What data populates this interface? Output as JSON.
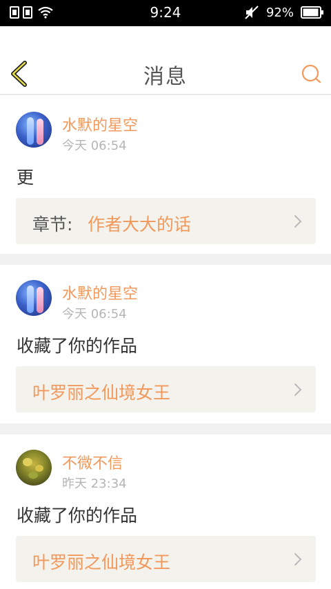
{
  "status_bar": {
    "time": "9:24",
    "battery": "92%",
    "icons": [
      "sim-card-icon",
      "sim-card-icon",
      "wifi-icon",
      "mute-icon",
      "battery-icon"
    ]
  },
  "header": {
    "title": "消息",
    "back_icon": "back-chevron-icon",
    "search_icon": "search-icon"
  },
  "accent_color": "#f2985a",
  "messages": [
    {
      "username": "水默的星空",
      "time": "今天 06:54",
      "text": "更",
      "link_prefix": "章节:",
      "link_title": "作者大大的话"
    },
    {
      "username": "水默的星空",
      "time": "今天 06:54",
      "text": "收藏了你的作品",
      "link_prefix": "",
      "link_title": "叶罗丽之仙境女王"
    },
    {
      "username": "不微不信",
      "time": "昨天 23:34",
      "text": "收藏了你的作品",
      "link_prefix": "",
      "link_title": "叶罗丽之仙境女王"
    }
  ]
}
